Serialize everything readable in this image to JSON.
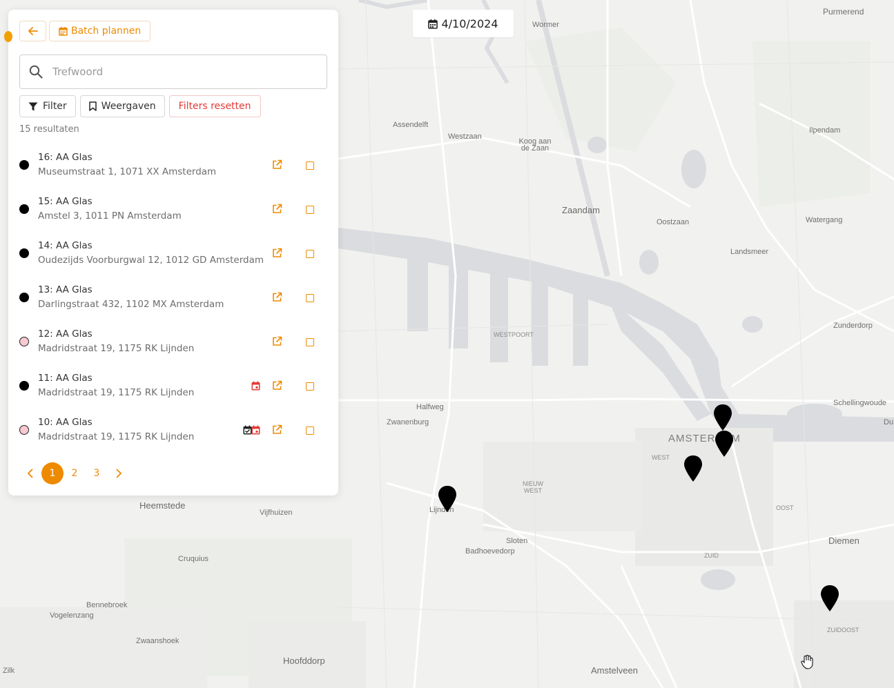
{
  "date_chip": {
    "label": "4/10/2024",
    "icon": "calendar-icon"
  },
  "toolbar": {
    "back_icon": "arrow-left-icon",
    "batch_label": "Batch plannen",
    "batch_icon": "calendar-icon"
  },
  "search": {
    "placeholder": "Trefwoord",
    "value": ""
  },
  "filters": {
    "filter_label": "Filter",
    "views_label": "Weergaven",
    "reset_label": "Filters resetten"
  },
  "results_count": "15 resultaten",
  "items": [
    {
      "title": "16: AA Glas",
      "address": "Museumstraat 1, 1071 XX Amsterdam",
      "status": "black",
      "icons": []
    },
    {
      "title": "15: AA Glas",
      "address": "Amstel 3, 1011 PN Amsterdam",
      "status": "black",
      "icons": []
    },
    {
      "title": "14: AA Glas",
      "address": "Oudezijds Voorburgwal 12, 1012 GD Amsterdam",
      "status": "black",
      "icons": []
    },
    {
      "title": "13: AA Glas",
      "address": "Darlingstraat 432, 1102 MX Amsterdam",
      "status": "black",
      "icons": []
    },
    {
      "title": "12: AA Glas",
      "address": "Madridstraat 19, 1175 RK Lijnden",
      "status": "pink",
      "icons": []
    },
    {
      "title": "11: AA Glas",
      "address": "Madridstraat 19, 1175 RK Lijnden",
      "status": "black",
      "icons": [
        "calendar-red-icon"
      ]
    },
    {
      "title": "10: AA Glas",
      "address": "Madridstraat 19, 1175 RK Lijnden",
      "status": "pink",
      "icons": [
        "calendar-check-icon",
        "calendar-red-icon"
      ]
    }
  ],
  "pagination": {
    "pages": [
      "1",
      "2",
      "3"
    ],
    "current": "1"
  },
  "map_labels": {
    "purmerend": "Purmerend",
    "wormer": "Wormer",
    "assendelft": "Assendelft",
    "westzaan": "Westzaan",
    "koog": "Koog aan de Zaan",
    "ilpendam": "Ilpendam",
    "zaandam": "Zaandam",
    "oostzaan": "Oostzaan",
    "watergang": "Watergang",
    "landsmeer": "Landsmeer",
    "zunderdorp": "Zunderdorp",
    "westpoort": "WESTPOORT",
    "halfweg": "Halfweg",
    "zwanenburg": "Zwanenburg",
    "schellingwoude": "Schellingwoude",
    "amsterdam": "AMSTERDAM",
    "west": "WEST",
    "nieuw_west": "NIEUW WEST",
    "oost": "OOST",
    "diemen": "Diemen",
    "heemstede": "Heemstede",
    "vijfhuizen": "Vijfhuizen",
    "lijnden": "Lijnden",
    "sloten": "Sloten",
    "badhoevedorp": "Badhoevedorp",
    "zuid": "ZUID",
    "cruquius": "Cruquius",
    "bennebroek": "Bennebroek",
    "vogelenzang": "Vogelenzang",
    "zwaanshoek": "Zwaanshoek",
    "hoofddorp": "Hoofddorp",
    "amstelveen": "Amstelveen",
    "zuidoost": "ZUIDOOST",
    "zilk": "Zilk",
    "du": "Du"
  },
  "colors": {
    "accent": "#ee8a00",
    "danger": "#e53935",
    "pin": "#000000",
    "pink_status": "#f7c9d1"
  }
}
